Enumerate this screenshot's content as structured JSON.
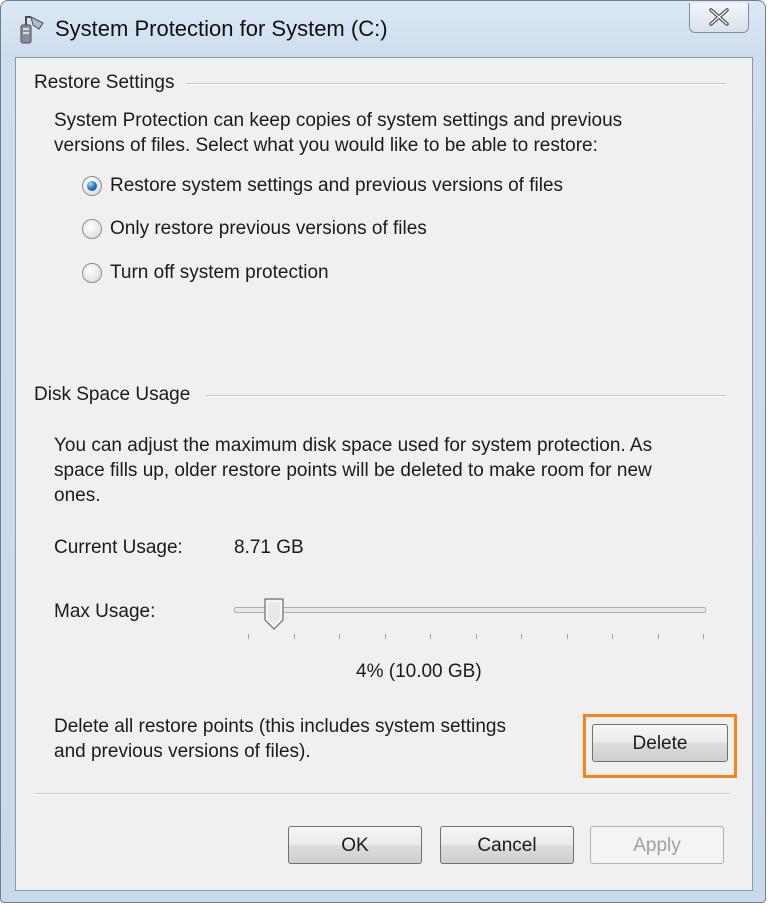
{
  "window": {
    "title": "System Protection for System (C:)",
    "icons": {
      "app": "system-protection-icon",
      "close": "close-icon"
    }
  },
  "restore_settings": {
    "group_title": "Restore Settings",
    "description": "System Protection can keep copies of system settings and previous versions of files. Select what you would like to be able to restore:",
    "description_lines": [
      "System Protection can keep copies of system settings and previous",
      "versions of files. Select what you would like to be able to restore:"
    ],
    "options": [
      {
        "label": "Restore system settings and previous versions of files",
        "checked": true
      },
      {
        "label": "Only restore previous versions of files",
        "checked": false
      },
      {
        "label": "Turn off system protection",
        "checked": false
      }
    ]
  },
  "disk_space": {
    "group_title": "Disk Space Usage",
    "description_lines": [
      "You can adjust the maximum disk space used for system protection. As",
      "space fills up, older restore points will be deleted to make room for new",
      "ones."
    ],
    "current_usage_label": "Current Usage:",
    "current_usage_value": "8.71 GB",
    "max_usage_label": "Max Usage:",
    "max_usage_fraction": 0.04,
    "max_usage_value": "4% (10.00 GB)"
  },
  "delete_section": {
    "description_lines": [
      "Delete all restore points (this includes system settings",
      "and previous versions of files)."
    ],
    "delete_label": "Delete",
    "highlight_color": "#f5841f"
  },
  "footer": {
    "ok_label": "OK",
    "cancel_label": "Cancel",
    "apply_label": "Apply",
    "apply_enabled": false
  }
}
